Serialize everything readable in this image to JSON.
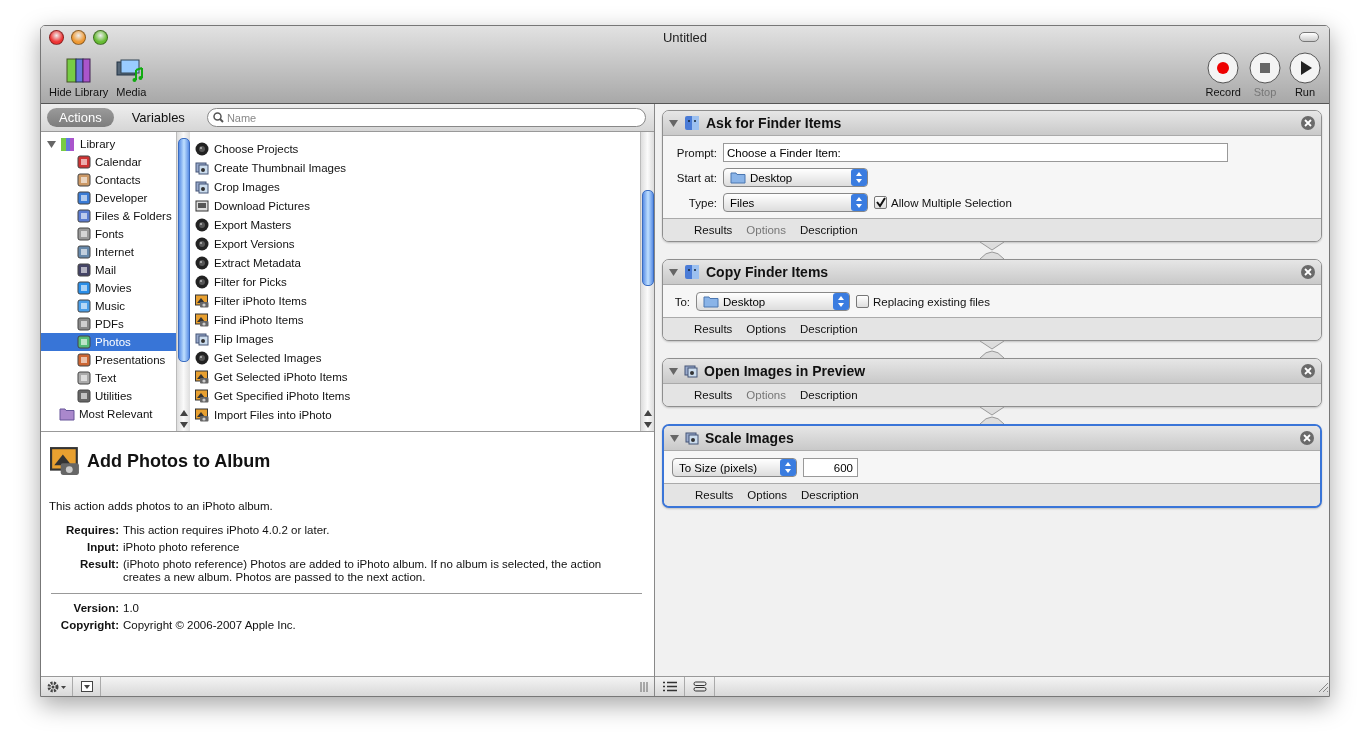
{
  "window": {
    "title": "Untitled"
  },
  "toolbar": {
    "left": [
      {
        "kind": "library",
        "label": "Hide Library"
      },
      {
        "kind": "media",
        "label": "Media"
      }
    ],
    "right": [
      {
        "kind": "record",
        "label": "Record",
        "disabled": false
      },
      {
        "kind": "stop",
        "label": "Stop",
        "disabled": true
      },
      {
        "kind": "run",
        "label": "Run",
        "disabled": false
      }
    ]
  },
  "library_tabs": [
    {
      "label": "Actions",
      "selected": true
    },
    {
      "label": "Variables",
      "selected": false
    }
  ],
  "search": {
    "placeholder": "Name"
  },
  "library": {
    "label": "Library",
    "expanded": true,
    "children": [
      {
        "label": "Calendar",
        "selected": false
      },
      {
        "label": "Contacts",
        "selected": false
      },
      {
        "label": "Developer",
        "selected": false
      },
      {
        "label": "Files & Folders",
        "selected": false
      },
      {
        "label": "Fonts",
        "selected": false
      },
      {
        "label": "Internet",
        "selected": false
      },
      {
        "label": "Mail",
        "selected": false
      },
      {
        "label": "Movies",
        "selected": false
      },
      {
        "label": "Music",
        "selected": false
      },
      {
        "label": "PDFs",
        "selected": false
      },
      {
        "label": "Photos",
        "selected": true
      },
      {
        "label": "Presentations",
        "selected": false
      },
      {
        "label": "Text",
        "selected": false
      },
      {
        "label": "Utilities",
        "selected": false
      }
    ]
  },
  "library_more": {
    "label": "Most Relevant"
  },
  "actions": [
    {
      "label": "Choose Projects",
      "kind": "aperture"
    },
    {
      "label": "Create Thumbnail Images",
      "kind": "preview"
    },
    {
      "label": "Crop Images",
      "kind": "preview"
    },
    {
      "label": "Download Pictures",
      "kind": "capture"
    },
    {
      "label": "Export Masters",
      "kind": "aperture"
    },
    {
      "label": "Export Versions",
      "kind": "aperture"
    },
    {
      "label": "Extract Metadata",
      "kind": "aperture"
    },
    {
      "label": "Filter for Picks",
      "kind": "aperture"
    },
    {
      "label": "Filter iPhoto Items",
      "kind": "iphoto"
    },
    {
      "label": "Find iPhoto Items",
      "kind": "iphoto"
    },
    {
      "label": "Flip Images",
      "kind": "preview"
    },
    {
      "label": "Get Selected Images",
      "kind": "aperture"
    },
    {
      "label": "Get Selected iPhoto Items",
      "kind": "iphoto"
    },
    {
      "label": "Get Specified iPhoto Items",
      "kind": "iphoto"
    },
    {
      "label": "Import Files into iPhoto",
      "kind": "iphoto"
    }
  ],
  "description": {
    "title": "Add Photos to Album",
    "summary": "This action adds photos to an iPhoto album.",
    "details": [
      {
        "label": "Requires:",
        "value": "This action requires iPhoto 4.0.2 or later."
      },
      {
        "label": "Input:",
        "value": "iPhoto photo reference"
      },
      {
        "label": "Result:",
        "value": "(iPhoto photo reference) Photos are added to iPhoto album. If no album is selected, the action creates a new album. Photos are passed to the next action."
      }
    ],
    "meta": [
      {
        "label": "Version:",
        "value": "1.0"
      },
      {
        "label": "Copyright:",
        "value": "Copyright © 2006-2007 Apple Inc."
      }
    ]
  },
  "workflow": [
    {
      "title": "Ask for Finder Items",
      "kind": "finder",
      "expanded": true,
      "selected": false,
      "rows": [
        {
          "label": "Prompt:",
          "controls": [
            {
              "kind": "text",
              "value": "Choose a Finder Item:"
            }
          ]
        },
        {
          "label": "Start at:",
          "controls": [
            {
              "kind": "folder_popup",
              "value": "Desktop"
            }
          ]
        },
        {
          "label": "Type:",
          "controls": [
            {
              "kind": "popup",
              "value": "Files"
            },
            {
              "kind": "checkbox",
              "label": "Allow Multiple Selection",
              "checked": true
            }
          ]
        }
      ],
      "tabs": [
        {
          "label": "Results",
          "disabled": false
        },
        {
          "label": "Options",
          "disabled": true
        },
        {
          "label": "Description",
          "disabled": false
        }
      ]
    },
    {
      "title": "Copy Finder Items",
      "kind": "finder",
      "expanded": true,
      "selected": false,
      "rows": [
        {
          "label": "To:",
          "controls": [
            {
              "kind": "folder_popup",
              "value": "Desktop"
            },
            {
              "kind": "checkbox",
              "label": "Replacing existing files",
              "checked": false
            }
          ]
        }
      ],
      "tabs": [
        {
          "label": "Results",
          "disabled": false
        },
        {
          "label": "Options",
          "disabled": false
        },
        {
          "label": "Description",
          "disabled": false
        }
      ]
    },
    {
      "title": "Open Images in Preview",
      "kind": "preview",
      "expanded": true,
      "selected": false,
      "tabs": [
        {
          "label": "Results",
          "disabled": false
        },
        {
          "label": "Options",
          "disabled": true
        },
        {
          "label": "Description",
          "disabled": false
        }
      ]
    },
    {
      "title": "Scale Images",
      "kind": "preview",
      "expanded": true,
      "selected": true,
      "rows": [
        {
          "controls": [
            {
              "kind": "popup",
              "value": "To Size (pixels)"
            },
            {
              "kind": "number",
              "value": "600"
            }
          ]
        }
      ],
      "tabs": [
        {
          "label": "Results",
          "disabled": false
        },
        {
          "label": "Options",
          "disabled": false
        },
        {
          "label": "Description",
          "disabled": false
        }
      ]
    }
  ]
}
